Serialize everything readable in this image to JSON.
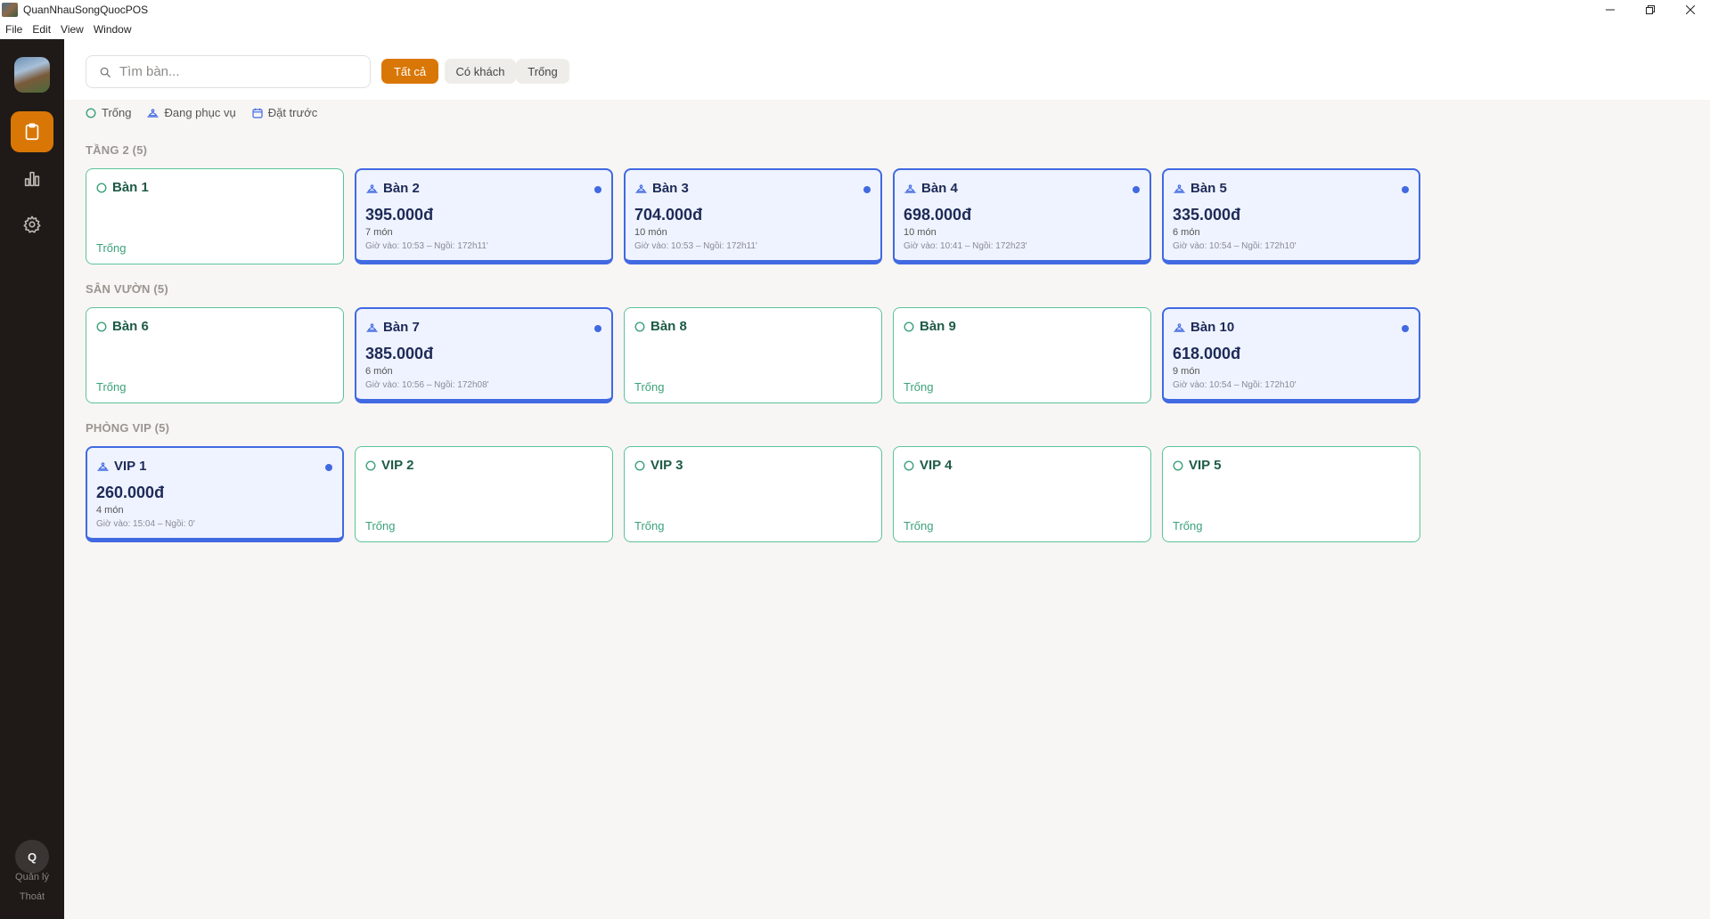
{
  "window": {
    "title": "QuanNhauSongQuocPOS"
  },
  "menu": [
    "File",
    "Edit",
    "View",
    "Window"
  ],
  "sidebar": {
    "nav": [
      {
        "icon": "clipboard-icon",
        "active": true
      },
      {
        "icon": "bar-chart-icon",
        "active": false
      },
      {
        "icon": "gear-icon",
        "active": false
      }
    ],
    "user_initial": "Q",
    "role": "Quản lý",
    "logout": "Thoát"
  },
  "search": {
    "placeholder": "Tìm bàn..."
  },
  "filters": [
    {
      "label": "Tất cả",
      "active": true
    },
    {
      "label": "Có khách",
      "active": false
    },
    {
      "label": "Trống",
      "active": false
    }
  ],
  "legend": [
    {
      "label": "Trống",
      "icon": "circle-icon",
      "color": "#3aa27a"
    },
    {
      "label": "Đang phục vụ",
      "icon": "waiter-icon",
      "color": "#4169e1"
    },
    {
      "label": "Đặt trước",
      "icon": "calendar-icon",
      "color": "#4169e1"
    }
  ],
  "colors": {
    "accent": "#d97706",
    "empty": "#5cc39a",
    "busy": "#4169e1",
    "sidebar": "#1f1a17"
  },
  "sections": [
    {
      "title": "TẦNG 2 (5)",
      "tables": [
        {
          "name": "Bàn 1",
          "state": "empty",
          "status": "Trống"
        },
        {
          "name": "Bàn 2",
          "state": "busy",
          "amount": "395.000đ",
          "items": "7 món",
          "time": "Giờ vào: 10:53 – Ngồi: 172h11'"
        },
        {
          "name": "Bàn 3",
          "state": "busy",
          "amount": "704.000đ",
          "items": "10 món",
          "time": "Giờ vào: 10:53 – Ngồi: 172h11'"
        },
        {
          "name": "Bàn 4",
          "state": "busy",
          "amount": "698.000đ",
          "items": "10 món",
          "time": "Giờ vào: 10:41 – Ngồi: 172h23'"
        },
        {
          "name": "Bàn 5",
          "state": "busy",
          "amount": "335.000đ",
          "items": "6 món",
          "time": "Giờ vào: 10:54 – Ngồi: 172h10'"
        }
      ]
    },
    {
      "title": "SÂN VƯỜN (5)",
      "tables": [
        {
          "name": "Bàn 6",
          "state": "empty",
          "status": "Trống"
        },
        {
          "name": "Bàn 7",
          "state": "busy",
          "amount": "385.000đ",
          "items": "6 món",
          "time": "Giờ vào: 10:56 – Ngồi: 172h08'"
        },
        {
          "name": "Bàn 8",
          "state": "empty",
          "status": "Trống"
        },
        {
          "name": "Bàn 9",
          "state": "empty",
          "status": "Trống"
        },
        {
          "name": "Bàn 10",
          "state": "busy",
          "amount": "618.000đ",
          "items": "9 món",
          "time": "Giờ vào: 10:54 – Ngồi: 172h10'"
        }
      ]
    },
    {
      "title": "PHÒNG VIP (5)",
      "tables": [
        {
          "name": "VIP 1",
          "state": "busy",
          "amount": "260.000đ",
          "items": "4 món",
          "time": "Giờ vào: 15:04 – Ngồi: 0'"
        },
        {
          "name": "VIP 2",
          "state": "empty",
          "status": "Trống"
        },
        {
          "name": "VIP 3",
          "state": "empty",
          "status": "Trống"
        },
        {
          "name": "VIP 4",
          "state": "empty",
          "status": "Trống"
        },
        {
          "name": "VIP 5",
          "state": "empty",
          "status": "Trống"
        }
      ]
    }
  ]
}
